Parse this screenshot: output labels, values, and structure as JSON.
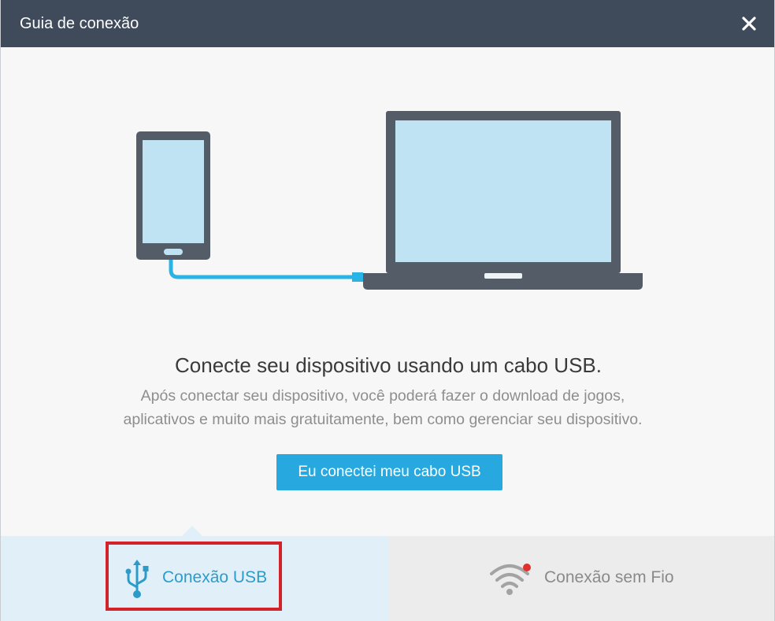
{
  "window": {
    "title": "Guia de conexão"
  },
  "main": {
    "headline": "Conecte seu dispositivo usando um cabo USB.",
    "description_lines": [
      "Após conectar seu dispositivo, você poderá fazer o download de jogos,",
      "aplicativos e muito mais gratuitamente, bem como gerenciar seu dispositivo."
    ],
    "confirm_button": "Eu conectei meu cabo USB"
  },
  "tabs": [
    {
      "label": "Conexão USB",
      "icon": "usb-icon",
      "selected": true
    },
    {
      "label": "Conexão sem Fio",
      "icon": "wifi-icon",
      "selected": false
    }
  ],
  "colors": {
    "titlebar": "#3f4a5b",
    "accent": "#27a8de",
    "device_frame": "#545c68",
    "screen": "#bfe3f3",
    "highlight_box": "#d2232a",
    "wifi_notification_dot": "#e0312d"
  }
}
